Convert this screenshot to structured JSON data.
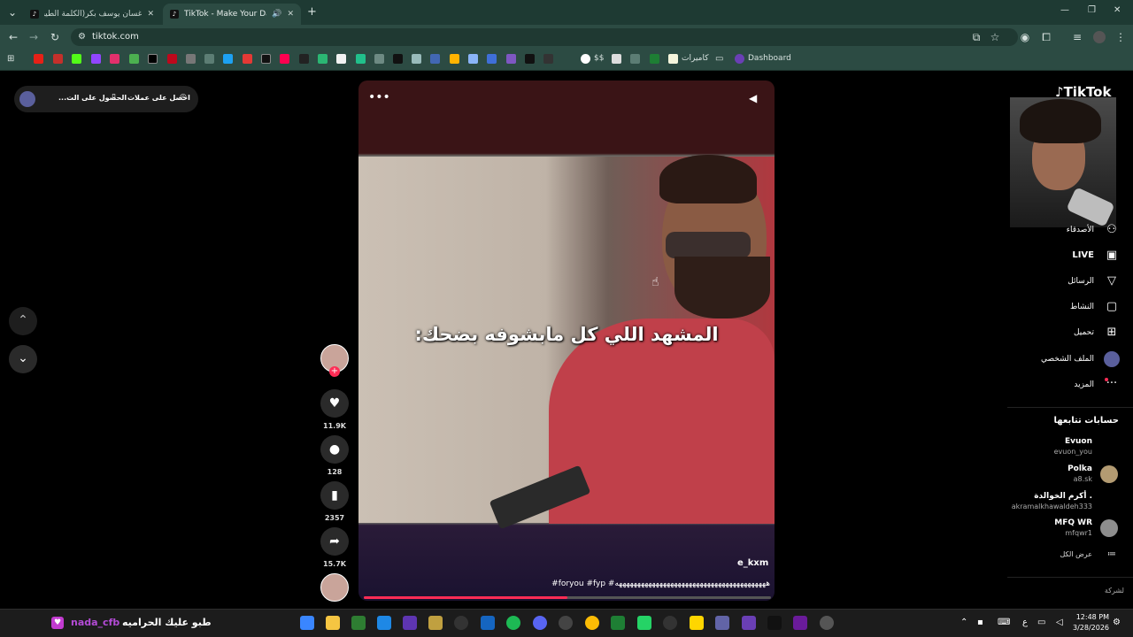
{
  "browser": {
    "tabs": [
      {
        "title": "غسان يوسف بكر(الكلمة الطيبة) (",
        "active": false
      },
      {
        "title": "TikTok - Make Your Day",
        "active": true
      }
    ],
    "new_tab": "+",
    "url": "tiktok.com",
    "bookmarks": {
      "item_ss": "$$",
      "item_cameras": "كاميرات",
      "item_dashboard": "Dashboard"
    }
  },
  "promo": {
    "get_coins": "احصل على عملات",
    "get_app": "الحصول على الت..."
  },
  "video": {
    "caption": "المشهد اللي كل مابشوفه بضحك:",
    "author": "e_kxm",
    "tags": "#foryou #fyp #هههههههههههههههههههههههههههههههههههههههههه",
    "progress": 0.5,
    "likes": "11.9K",
    "comments": "128",
    "saves": "2357",
    "shares": "15.7K"
  },
  "sidebar": {
    "logo": "TikTok",
    "nav": {
      "following": "الأصدقاء",
      "live": "LIVE",
      "messages": "الرسائل",
      "activity": "النشاط",
      "upload": "تحميل",
      "profile": "الملف الشخصي",
      "more": "المزيد"
    },
    "following_title": "حسابات تتابعها",
    "accounts": [
      {
        "name": "Evuon",
        "handle": "evuon_you"
      },
      {
        "name": "Polka",
        "handle": "a8.sk"
      },
      {
        "name": "أكرم الخوالدة .",
        "handle": "akramalkhawaldeh333"
      },
      {
        "name": "MFQ WR",
        "handle": "mfqwr1"
      }
    ],
    "see_all": "عرض الكل",
    "company": "لشركة"
  },
  "taskbar": {
    "user": "nada_cfb",
    "song": "طبو عليك الحراميه",
    "lang": "ع",
    "time": "12:48 PM",
    "date": "3/28/2026"
  },
  "colors": {
    "accent": "#fe2c55",
    "tab_bg": "#1e3a33",
    "toolbar_bg": "#2c4b43"
  }
}
